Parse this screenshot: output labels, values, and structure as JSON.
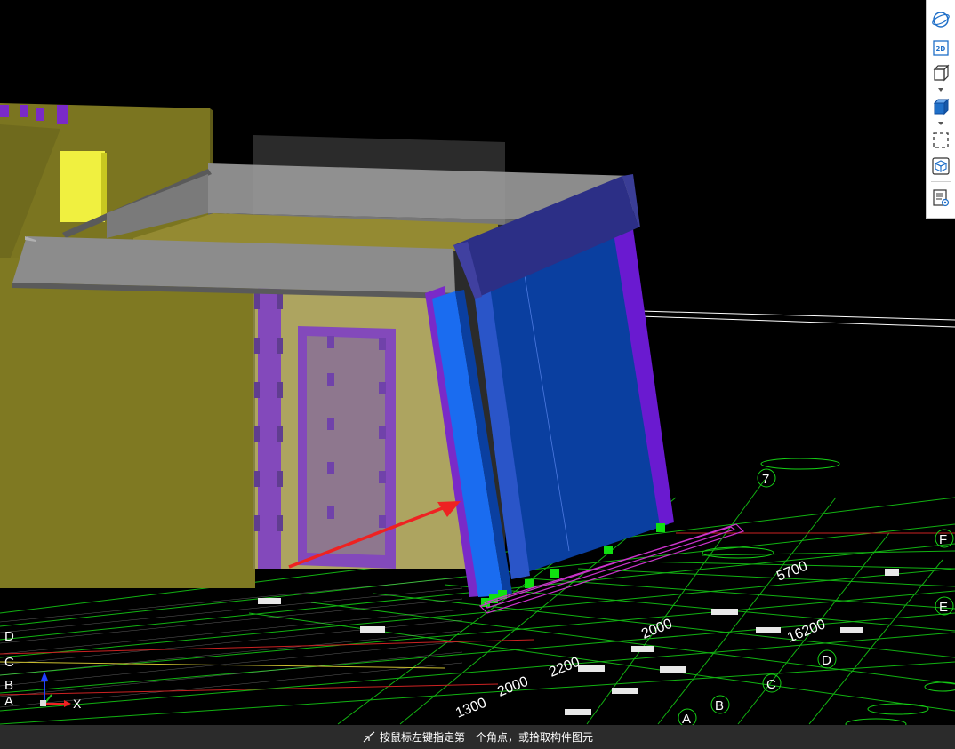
{
  "viewport": {
    "background": "#000000",
    "grid_labels": {
      "right": [
        "F",
        "E",
        "D",
        "C",
        "B",
        "A"
      ],
      "left": [
        "D",
        "C",
        "B",
        "A"
      ],
      "top": [
        "7"
      ]
    },
    "dimensions": [
      "5700",
      "16200",
      "2000",
      "2200",
      "2000",
      "1300"
    ],
    "axis_x_label": "X"
  },
  "toolbar": {
    "items": [
      {
        "name": "orbit-icon"
      },
      {
        "name": "2d-view-icon",
        "text": "2D"
      },
      {
        "name": "3d-view-icon"
      },
      {
        "name": "shaded-view-icon"
      },
      {
        "name": "selection-box-icon"
      },
      {
        "name": "component-cube-icon"
      },
      {
        "name": "properties-list-icon"
      }
    ],
    "two_d_label": "2D"
  },
  "status": {
    "message": "按鼠标左键指定第一个角点，或拾取构件图元"
  },
  "colors": {
    "wall_olive": "#7b7520",
    "wall_yellow": "#b4a84a",
    "column_purple": "#7a2ac8",
    "glass_blue": "#0a3fa0",
    "edge_blue": "#1a6cf0",
    "beam_gray": "#8c8c8c",
    "grid_green": "#16d216",
    "marker_green": "#10e010",
    "arrow_red": "#ee2222"
  }
}
